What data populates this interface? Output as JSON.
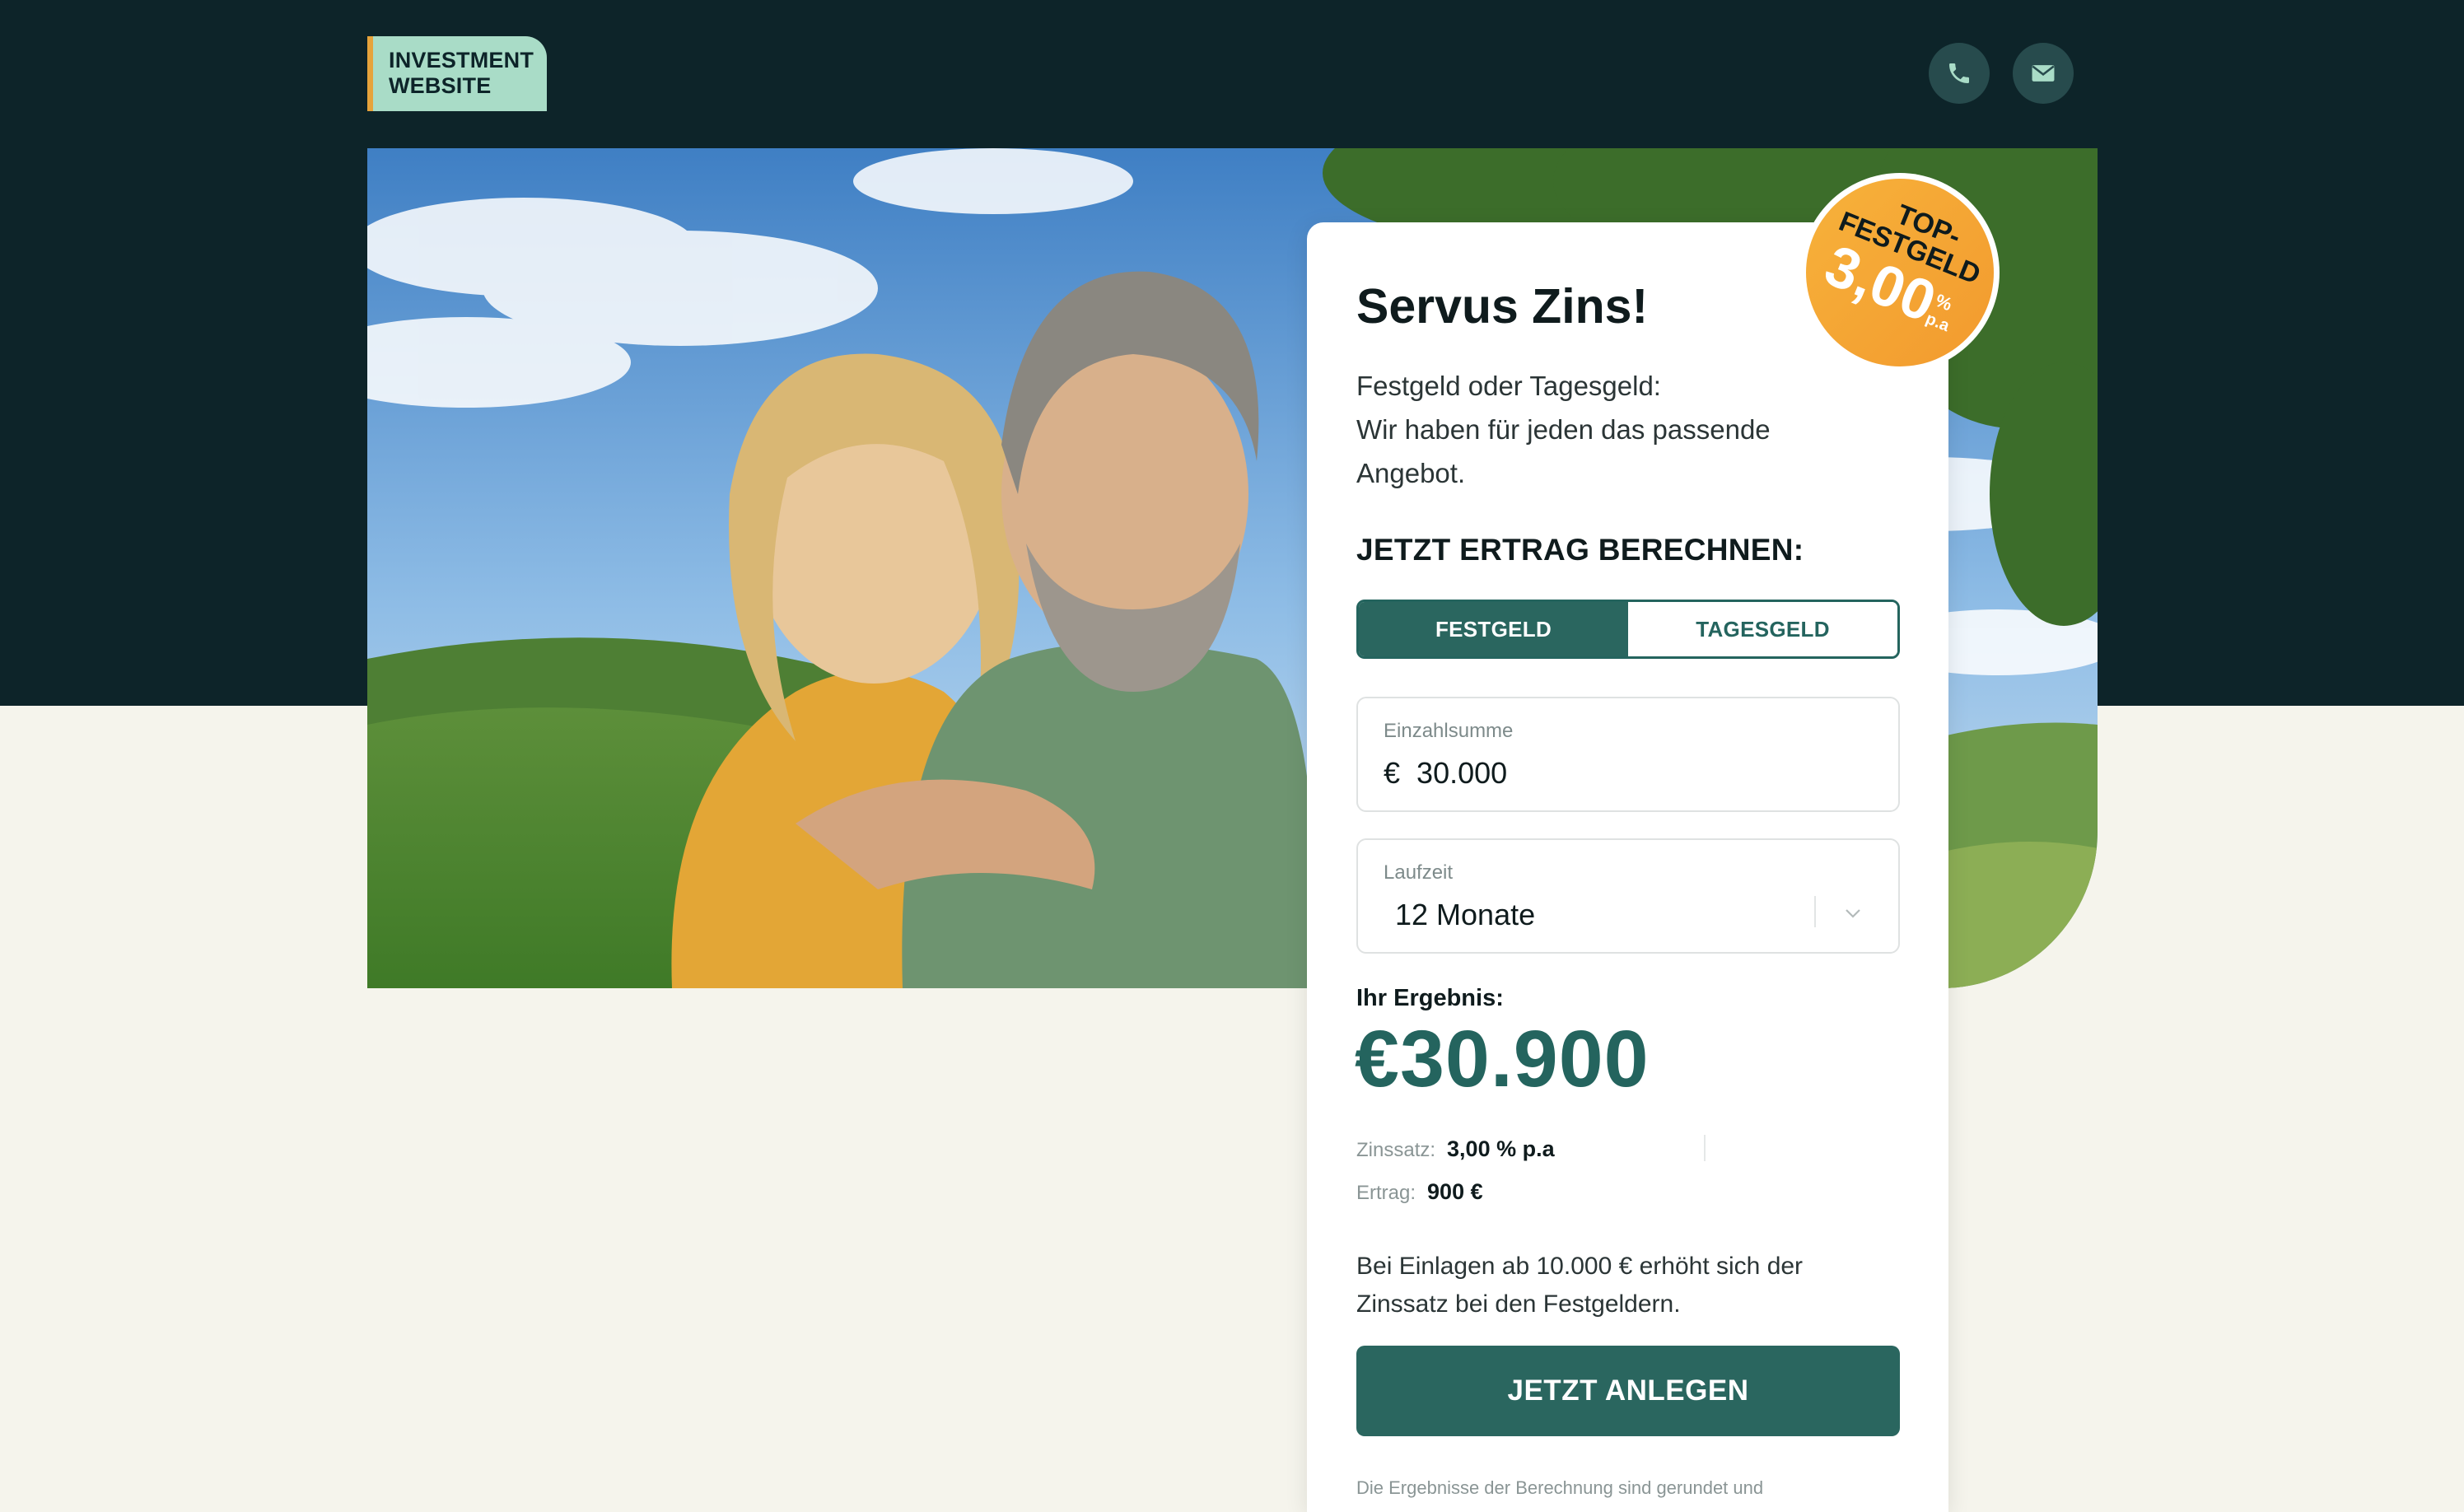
{
  "header": {
    "logo_line1": "INVESTMENT",
    "logo_line2": "WEBSITE",
    "phone_icon": "phone-icon",
    "mail_icon": "mail-icon"
  },
  "badge": {
    "line1": "TOP-",
    "line2": "FESTGELD",
    "rate": "3,00",
    "percent": "%",
    "suffix": "p.a"
  },
  "card": {
    "title": "Servus Zins!",
    "subtitle_lines": [
      "Festgeld oder Tagesgeld:",
      "Wir haben für jeden das passende",
      "Angebot."
    ],
    "calc_heading": "JETZT ERTRAG BERECHNEN:",
    "tabs": [
      {
        "label": "FESTGELD",
        "active": true
      },
      {
        "label": "TAGESGELD",
        "active": false
      }
    ],
    "deposit": {
      "label": "Einzahlsumme",
      "currency": "€",
      "value": "30.000"
    },
    "term": {
      "label": "Laufzeit",
      "value": "12 Monate"
    },
    "result_label": "Ihr Ergebnis:",
    "result_value": "€30.900",
    "rate_label": "Zinssatz:",
    "rate_value": "3,00 % p.a",
    "yield_label": "Ertrag:",
    "yield_value": "900 €",
    "note_lines": [
      "Bei Einlagen ab 10.000 € erhöht sich der",
      "Zinssatz bei den Festgeldern."
    ],
    "cta_label": "JETZT ANLEGEN",
    "footnote": "Die Ergebnisse der Berechnung sind gerundet und"
  },
  "colors": {
    "dark_band": "#0d2429",
    "accent_green": "#2a665f",
    "logo_bg": "#a9dcc7",
    "logo_stripe": "#e6a33b",
    "badge_orange": "#f3a833",
    "page_bg": "#f5f4ec"
  }
}
